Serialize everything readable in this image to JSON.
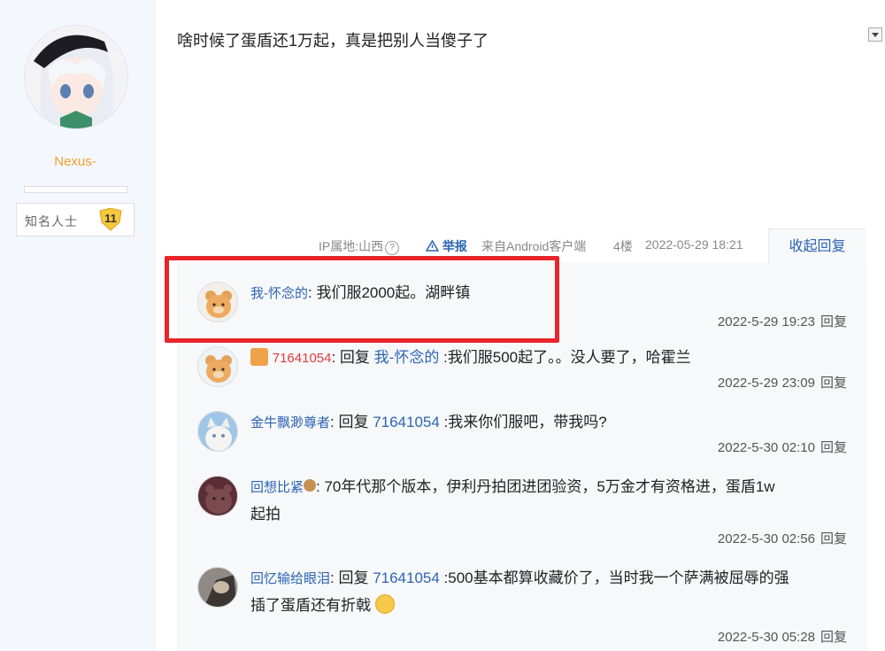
{
  "sidebar": {
    "username": "Nexus-",
    "badge_title": "知名人士",
    "badge_level": "11"
  },
  "post": {
    "text": "啥时候了蛋盾还1万起，真是把别人当傻子了",
    "ip_label": "IP属地:山西",
    "report_label": "举报",
    "client": "来自Android客户端",
    "floor": "4楼",
    "datetime": "2022-05-29 18:21",
    "collapse_label": "收起回复"
  },
  "replies": [
    {
      "name": "我-怀念的",
      "text": ": 我们服2000起。湖畔镇",
      "time": "2022-5-29 19:23",
      "reply_label": "回复"
    },
    {
      "name": "71641054",
      "prefix": ": 回复 ",
      "target": "我-怀念的",
      "text": " :我们服500起了。。没人要了，哈霍兰",
      "time": "2022-5-29 23:09",
      "reply_label": "回复"
    },
    {
      "name": "金牛飘渺尊者",
      "prefix": ": 回复 ",
      "target": "71641054",
      "text": " :我来你们服吧，带我吗?",
      "time": "2022-5-30 02:10",
      "reply_label": "回复"
    },
    {
      "name": "回想比紧",
      "text": ": 70年代那个版本，伊利丹拍团进团验资，5万金才有资格进，蛋盾1w",
      "text2": "起拍",
      "time": "2022-5-30 02:56",
      "reply_label": "回复"
    },
    {
      "name": "回忆输给眼泪",
      "prefix": ": 回复 ",
      "target": "71641054",
      "text": " :500基本都算收藏价了，当时我一个萨满被屈辱的强",
      "text2": "插了蛋盾还有折戟",
      "time": "2022-5-30 05:28",
      "reply_label": "回复"
    }
  ],
  "colors": {
    "link": "#2d64b3",
    "highlight": "#e8252a",
    "username": "#f0a030"
  }
}
